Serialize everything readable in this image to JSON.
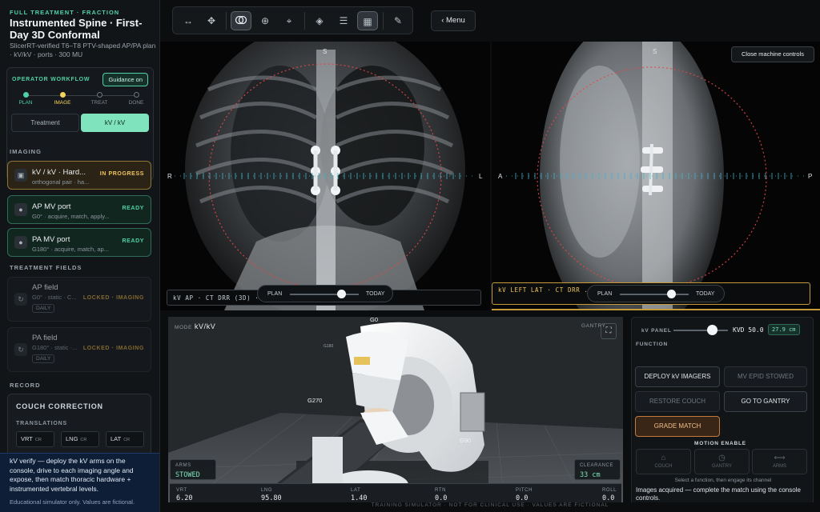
{
  "sidebar": {
    "eyebrow": "FULL TREATMENT · FRACTION",
    "title": "Instrumented Spine · First-Day 3D Conformal",
    "subtitle": "SlicerRT-verified T6–T8 PTV-shaped AP/PA plan · kV/kV · ports · 300 MU",
    "workflow_label": "OPERATOR WORKFLOW",
    "guidance_label": "Guidance on",
    "steps": [
      {
        "label": "PLAN",
        "state": "done"
      },
      {
        "label": "IMAGE",
        "state": "active"
      },
      {
        "label": "TREAT",
        "state": "pending"
      },
      {
        "label": "DONE",
        "state": "pending"
      }
    ],
    "mode_tabs": [
      {
        "label": "Treatment",
        "selected": false
      },
      {
        "label": "kV / kV",
        "selected": true
      }
    ],
    "imaging_label": "IMAGING",
    "imaging": [
      {
        "title": "kV / kV · Hard...",
        "sub": "orthogonal pair · ha...",
        "status": "IN PROGRESS"
      },
      {
        "title": "AP MV port",
        "sub": "G0° · acquire, match, apply...",
        "status": "READY"
      },
      {
        "title": "PA MV port",
        "sub": "G180° · acquire, match, ap...",
        "status": "READY"
      }
    ],
    "fields_label": "TREATMENT FIELDS",
    "fields": [
      {
        "title": "AP field",
        "sub": "G0° · static · C...",
        "pill": "DAILY",
        "status": "LOCKED · IMAGING"
      },
      {
        "title": "PA field",
        "sub": "G180° · static ·...",
        "pill": "DAILY",
        "status": "LOCKED · IMAGING"
      }
    ],
    "record_label": "RECORD",
    "couch": {
      "title": "COUCH CORRECTION",
      "translations_label": "TRANSLATIONS",
      "axes": [
        {
          "label": "VRT",
          "unit": "CR"
        },
        {
          "label": "LNG",
          "unit": "CR"
        },
        {
          "label": "LAT",
          "unit": "CR"
        }
      ]
    },
    "verify": {
      "text": "kV verify — deploy the kV arms on the console, drive to each imaging angle and expose, then match thoracic hardware + instrumented vertebral levels.",
      "fine_print": "Educational simulator only. Values are fictional."
    }
  },
  "toolbar": {
    "icons": [
      "arrows-horizontal-icon",
      "move-icon",
      "overlay-icon",
      "zoom-icon",
      "crosshair-icon",
      "flip-icon",
      "sliders-icon",
      "grid-icon",
      "pencil-icon"
    ],
    "active": [
      2,
      7
    ],
    "menu_label": "‹ Menu"
  },
  "views": {
    "ap": {
      "top": "S",
      "left": "R",
      "right": "L",
      "caption": "kV AP · CT DRR (3D) · ... ed vertebral levels",
      "slider_left": "PLAN",
      "slider_right": "TODAY",
      "slider_value": 0.75
    },
    "lat": {
      "top": "S",
      "left": "A",
      "right": "P",
      "caption": "kV LEFT LAT · CT DRR ... umented vertebral levels",
      "slider_left": "PLAN",
      "slider_right": "TODAY",
      "slider_value": 0.75,
      "close_label": "Close machine controls"
    }
  },
  "room": {
    "mode_label": "MODE",
    "mode_value": "kV/kV",
    "gantry_label": "GANTRY",
    "g0": "G0",
    "g270": "G270",
    "g90": "G90",
    "g180": "G180",
    "arms_label": "ARMS",
    "arms_value": "STOWED",
    "clearance_label": "CLEARANCE",
    "clearance_value": "33 cm",
    "readouts": [
      {
        "label": "VRT",
        "value": "6.20"
      },
      {
        "label": "LNG",
        "value": "95.80"
      },
      {
        "label": "LAT",
        "value": "1.40"
      },
      {
        "label": "RTN",
        "value": "0.0"
      },
      {
        "label": "PITCH",
        "value": "0.0"
      },
      {
        "label": "ROLL",
        "value": "0.0"
      }
    ]
  },
  "controls": {
    "kv_panel_label": "kV PANEL",
    "kv_panel_slider": 0.7,
    "kvd_label": "KVD 50.0",
    "kvd_badge": "27.9 cm",
    "function_label": "FUNCTION",
    "buttons": [
      {
        "label": "DEPLOY kV IMAGERS",
        "state": "normal"
      },
      {
        "label": "MV EPID STOWED",
        "state": "disabled"
      },
      {
        "label": "RESTORE COUCH",
        "state": "disabled"
      },
      {
        "label": "GO TO GANTRY",
        "state": "normal"
      },
      {
        "label": "GRADE MATCH",
        "state": "hot"
      }
    ],
    "motion_label": "MOTION ENABLE",
    "motion": [
      {
        "label": "COUCH",
        "icon": "couch-icon"
      },
      {
        "label": "GANTRY",
        "icon": "timer-icon"
      },
      {
        "label": "ARMS",
        "icon": "arms-icon"
      }
    ],
    "hint": "Select a function, then engage its channel",
    "status": "Images acquired — complete the match using the console controls."
  },
  "footer": "TRAINING SIMULATOR · NOT FOR CLINICAL USE · VALUES ARE FICTIONAL",
  "colors": {
    "accent": "#4fd1a5",
    "warning": "#f2c55c",
    "hot": "#c47a3e"
  }
}
